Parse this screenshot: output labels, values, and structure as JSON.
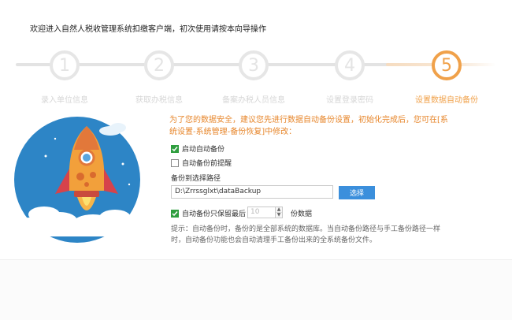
{
  "window": {
    "title": "欢迎进入自然人税收管理系统扣缴客户端，初次使用请按本向导操作"
  },
  "colors": {
    "accent": "#f0a14a",
    "inactive": "#e6e6e6",
    "notice": "#e7862b",
    "button": "#3b8fdc",
    "checkbox": "#2f9e3f"
  },
  "steps": [
    {
      "number": "1",
      "label": "录入单位信息",
      "active": false
    },
    {
      "number": "2",
      "label": "获取办税信息",
      "active": false
    },
    {
      "number": "3",
      "label": "备案办税人员信息",
      "active": false
    },
    {
      "number": "4",
      "label": "设置登录密码",
      "active": false
    },
    {
      "number": "5",
      "label": "设置数据自动备份",
      "active": true
    }
  ],
  "panel": {
    "intro": "为了您的数据安全，建议您先进行数据自动备份设置，初始化完成后，您可在[系统设置-系统管理-备份恢复]中修改：",
    "auto_backup": {
      "label": "启动自动备份",
      "checked": true
    },
    "exit_remind": {
      "label": "自动备份前提醒",
      "checked": false
    },
    "path_label": "备份到选择路径",
    "path_value": "D:\\Zrrssglxt\\dataBackup",
    "browse_label": "选择",
    "keep_recent": {
      "label": "自动备份只保留最后",
      "checked": true
    },
    "keep_count": "10",
    "keep_unit": "份数据",
    "hint": "提示：自动备份时，备份的是全部系统的数据库。当自动备份路径与手工备份路径一样时，自动备份功能也会自动清理手工备份出来的全系统备份文件。"
  },
  "illustration": {
    "icon": "rocket-icon"
  }
}
